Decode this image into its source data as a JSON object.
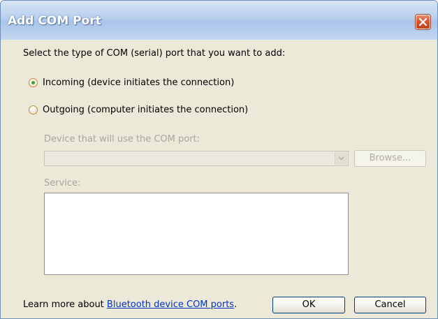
{
  "window": {
    "title": "Add COM Port"
  },
  "prompt": "Select the type of COM (serial) port that you want to add:",
  "options": {
    "incoming_label": "Incoming (device initiates the connection)",
    "incoming_selected": true,
    "outgoing_label": "Outgoing (computer initiates the connection)",
    "outgoing_selected": false
  },
  "device": {
    "label": "Device that will use the COM port:",
    "value": "",
    "browse_label": "Browse..."
  },
  "service": {
    "label": "Service:"
  },
  "footer": {
    "learn_prefix": "Learn more about ",
    "learn_link": "Bluetooth device COM ports",
    "learn_suffix": ".",
    "ok_label": "OK",
    "cancel_label": "Cancel"
  },
  "icons": {
    "close": "close-icon",
    "dropdown": "chevron-down-icon"
  },
  "colors": {
    "dialog_bg": "#ece9d8",
    "title_bg": "#b7cfee",
    "close_red": "#d4532f",
    "radio_selected": "#3ca23a",
    "link": "#0033cc"
  }
}
